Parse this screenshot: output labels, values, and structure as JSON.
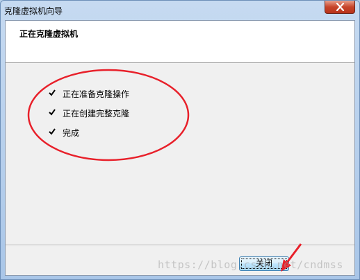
{
  "window": {
    "title": "克隆虚拟机向导"
  },
  "header": {
    "title": "正在克隆虚拟机"
  },
  "steps": [
    {
      "label": "正在准备克隆操作",
      "status": "done"
    },
    {
      "label": "正在创建完整克隆",
      "status": "done"
    },
    {
      "label": "完成",
      "status": "done"
    }
  ],
  "footer": {
    "close_label": "关闭"
  },
  "watermark": "https://blog.csdn.net/cndmss",
  "colors": {
    "annotation_red": "#e8202a",
    "close_caption_button": "#c7452b",
    "button_border": "#3c7fb1"
  }
}
